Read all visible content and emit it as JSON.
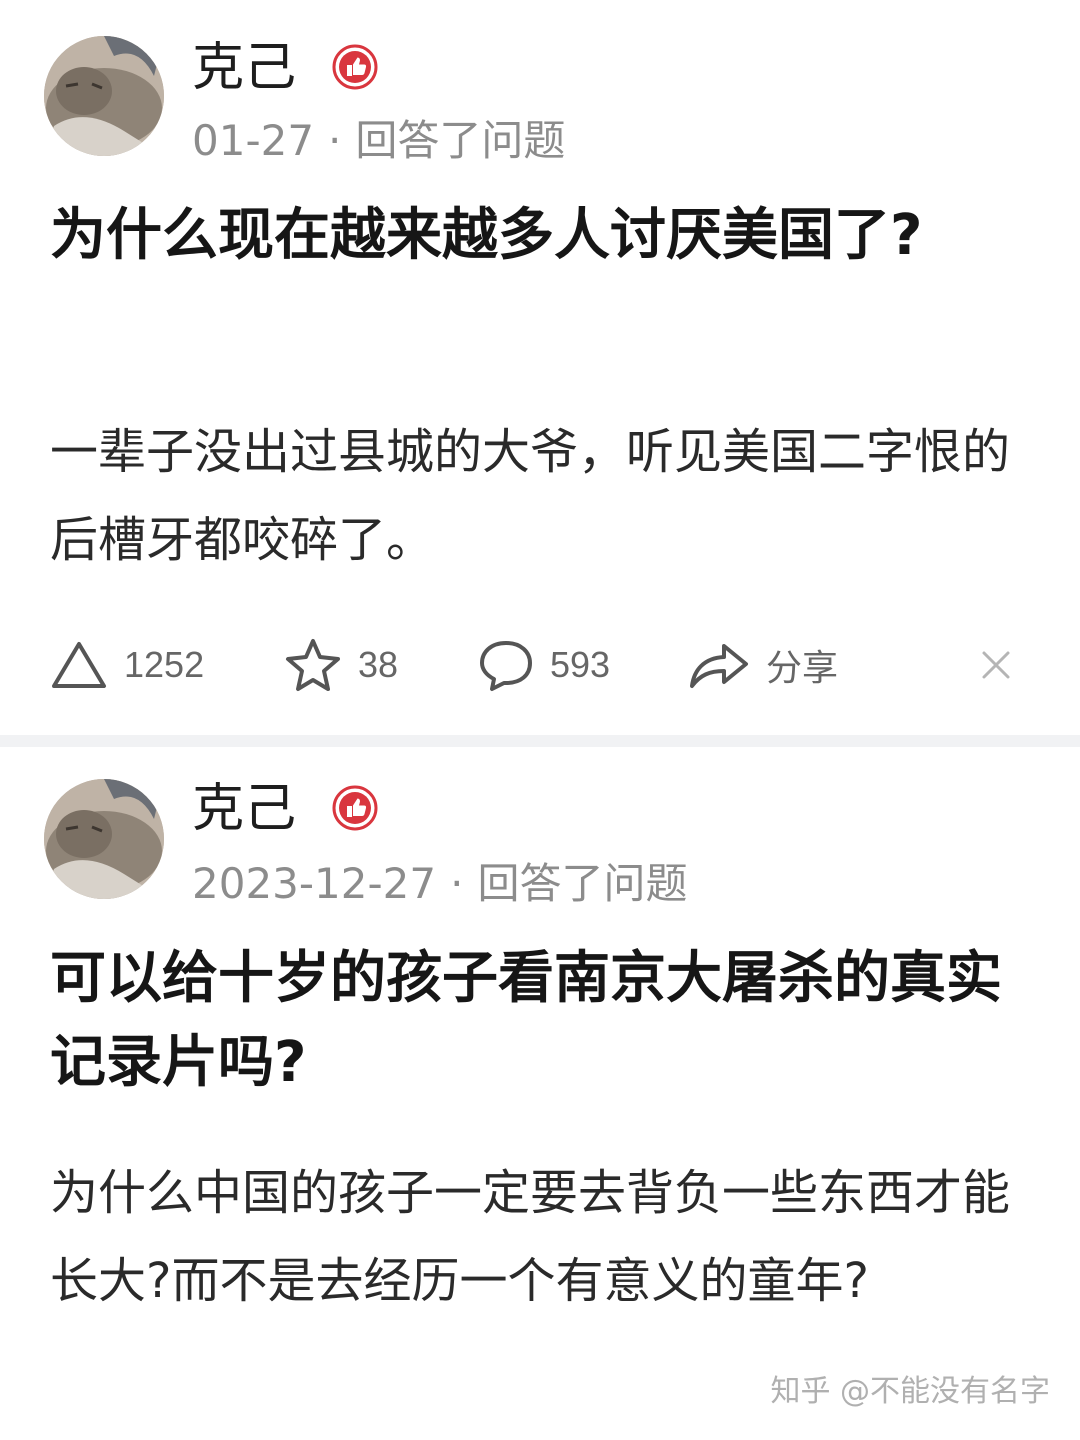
{
  "feed": [
    {
      "author": "克己",
      "date": "01-27",
      "action": "回答了问题",
      "question": "为什么现在越来越多人讨厌美国了?",
      "excerpt": "一辈子没出过县城的大爷，听见美国二字恨的后槽牙都咬碎了。",
      "upvotes": "1252",
      "favorites": "38",
      "comments": "593",
      "share_label": "分享"
    },
    {
      "author": "克己",
      "date": "2023-12-27",
      "action": "回答了问题",
      "question": "可以给十岁的孩子看南京大屠杀的真实记录片吗?",
      "excerpt": "为什么中国的孩子一定要去背负一些东西才能长大?而不是去经历一个有意义的童年?"
    }
  ],
  "separator": "·",
  "watermark": "知乎 @不能没有名字",
  "icons": {
    "badge": "thumb-up-badge-icon",
    "upvote": "triangle-upvote-icon",
    "favorite": "star-icon",
    "comment": "comment-bubble-icon",
    "share": "share-arrow-icon",
    "dismiss": "close-icon"
  },
  "colors": {
    "badge": "#d9363e",
    "meta": "#8c8c8c",
    "icon": "#555555"
  }
}
